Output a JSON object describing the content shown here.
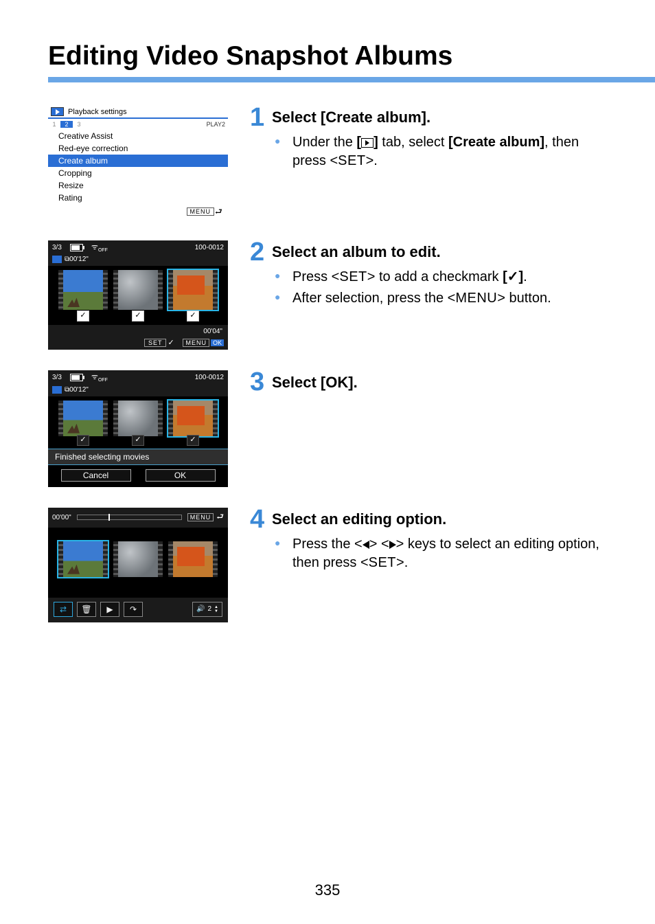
{
  "page_title": "Editing Video Snapshot Albums",
  "page_number": "335",
  "steps": {
    "s1": {
      "num": "1",
      "heading": "Select [Create album].",
      "b1_pre": "Under the ",
      "b1_bold1": "[",
      "b1_bold2": "]",
      "b1_mid": " tab, select ",
      "b1_bold3": "[Create album]",
      "b1_post": ", then press <",
      "b1_set": "SET",
      "b1_end": ">."
    },
    "s2": {
      "num": "2",
      "heading": "Select an album to edit.",
      "b1_pre": "Press <",
      "b1_set": "SET",
      "b1_mid": "> to add a checkmark ",
      "b1_mark": "[✓]",
      "b1_end": ".",
      "b2_pre": "After selection, press the <",
      "b2_menu": "MENU",
      "b2_end": "> button."
    },
    "s3": {
      "num": "3",
      "heading": "Select [OK]."
    },
    "s4": {
      "num": "4",
      "heading": "Select an editing option.",
      "b1_pre": "Press the <",
      "b1_mid": "> <",
      "b1_post": "> keys to select an editing option, then press <",
      "b1_set": "SET",
      "b1_end": ">."
    }
  },
  "lcd1": {
    "header": "Playback settings",
    "tab_label": "PLAY2",
    "tabs": {
      "t1": "1",
      "t2": "2",
      "t3": "3"
    },
    "items": {
      "i1": "Creative Assist",
      "i2": "Red-eye correction",
      "i3": "Create album",
      "i4": "Cropping",
      "i5": "Resize",
      "i6": "Rating"
    },
    "menu_btn": "MENU"
  },
  "lcd2": {
    "counter": "3/3",
    "wifi": "OFF",
    "file": "100-0012",
    "duration": "00'12\"",
    "snapshot_time": "00'04\"",
    "set": "SET",
    "menu": "MENU",
    "ok": "OK"
  },
  "lcd3": {
    "counter": "3/3",
    "wifi": "OFF",
    "file": "100-0012",
    "duration": "00'12\"",
    "message": "Finished selecting movies",
    "cancel": "Cancel",
    "ok": "OK"
  },
  "lcd4": {
    "time": "00'00\"",
    "menu": "MENU",
    "volume": "2"
  }
}
